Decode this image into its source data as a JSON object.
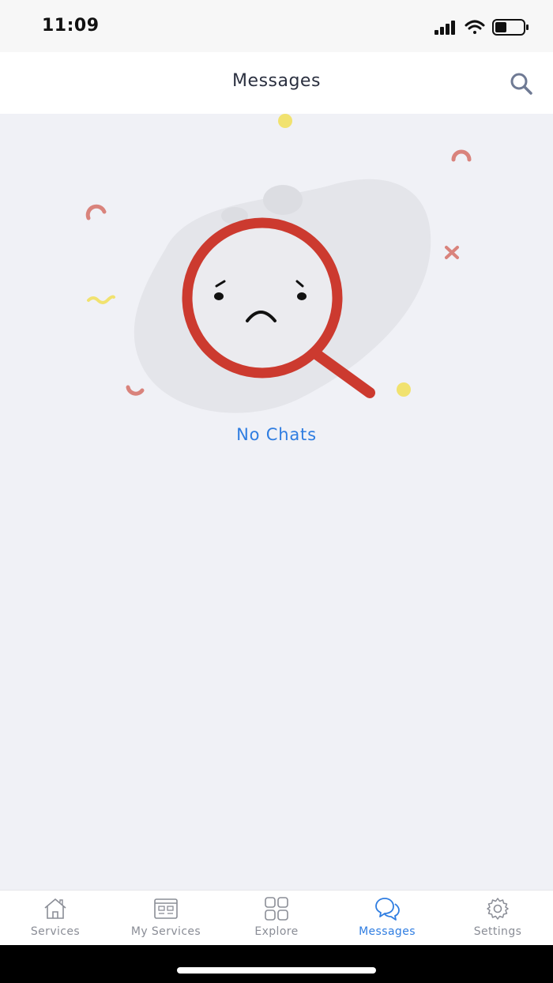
{
  "status_bar": {
    "time": "11:09",
    "signal_icon": "cellular-signal-icon",
    "wifi_icon": "wifi-icon",
    "battery_icon": "battery-icon"
  },
  "header": {
    "title": "Messages",
    "search_icon": "search-icon"
  },
  "empty_state": {
    "illustration_icon": "sad-magnifier-icon",
    "text": "No Chats"
  },
  "tabbar": {
    "tabs": [
      {
        "label": "Services",
        "icon": "home-icon",
        "active": false
      },
      {
        "label": "My Services",
        "icon": "dashboard-icon",
        "active": false
      },
      {
        "label": "Explore",
        "icon": "grid-icon",
        "active": false
      },
      {
        "label": "Messages",
        "icon": "chat-bubbles-icon",
        "active": true
      },
      {
        "label": "Settings",
        "icon": "gear-icon",
        "active": false
      }
    ]
  },
  "colors": {
    "accent": "#2f7de1",
    "background": "#f0f1f6",
    "magnifier_red": "#cc3a2f",
    "inactive_tab": "#8a8d96"
  }
}
